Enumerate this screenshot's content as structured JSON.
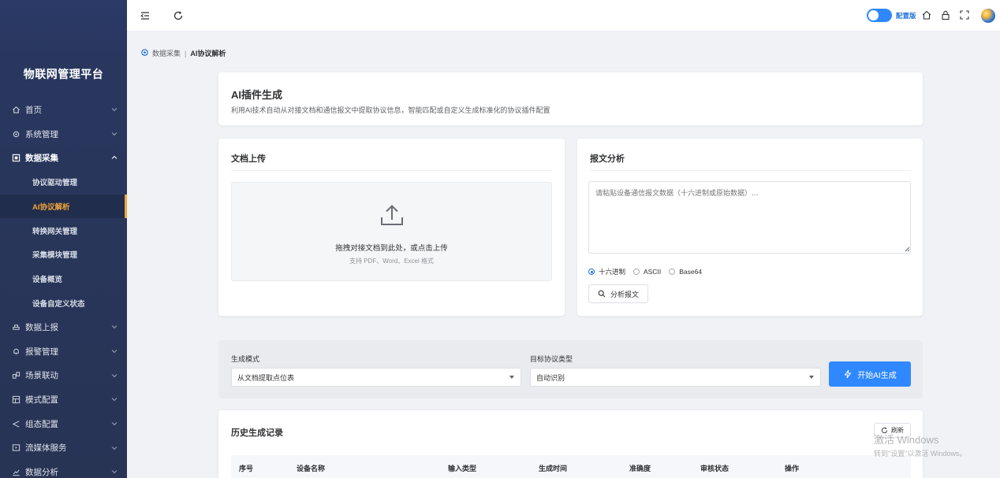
{
  "sidebar": {
    "brand": "物联网管理平台",
    "menu": [
      {
        "label": "首页",
        "icon": "home-icon"
      },
      {
        "label": "系统管理",
        "icon": "settings-icon"
      },
      {
        "label": "数据采集",
        "icon": "monitor-icon"
      }
    ],
    "sub_items": [
      "协议驱动管理",
      "AI协议解析",
      "转换网关管理",
      "采集模块管理",
      "设备概览",
      "设备自定义状态"
    ],
    "menu_after": [
      {
        "label": "数据上报",
        "icon": "upload-cloud-icon"
      },
      {
        "label": "报警管理",
        "icon": "bell-icon"
      },
      {
        "label": "场景联动",
        "icon": "link-icon"
      },
      {
        "label": "模式配置",
        "icon": "grid-icon"
      },
      {
        "label": "组态配置",
        "icon": "share-icon"
      },
      {
        "label": "流媒体服务",
        "icon": "media-icon"
      },
      {
        "label": "数据分析",
        "icon": "chart-icon"
      }
    ]
  },
  "header": {
    "toggle_label": "配置版",
    "icons": [
      "menu-fold-icon",
      "refresh-icon",
      "home-icon",
      "lock-icon",
      "fullscreen-icon"
    ]
  },
  "breadcrumb": {
    "parent": "数据采集",
    "separator": "|",
    "current": "AI协议解析"
  },
  "intro": {
    "title": "AI插件生成",
    "description": "利用AI技术自动从对接文档和通信报文中提取协议信息，智能匹配或自定义生成标准化的协议插件配置"
  },
  "upload_card": {
    "title": "文档上传",
    "main_text": "拖拽对接文档到此处，或点击上传",
    "sub_text": "支持 PDF、Word、Excel 格式"
  },
  "analysis_card": {
    "title": "报文分析",
    "placeholder": "请粘贴设备通信报文数据（十六进制或原始数据）...",
    "formats": [
      "十六进制",
      "ASCII",
      "Base64"
    ],
    "selected_format": "十六进制",
    "analyze_label": "分析报文"
  },
  "generate": {
    "mode_label": "生成模式",
    "mode_value": "从文档提取点位表",
    "protocol_label": "目标协议类型",
    "protocol_value": "自动识别",
    "button_label": "开始AI生成"
  },
  "history": {
    "title": "历史生成记录",
    "refresh_label": "刷新",
    "columns": [
      "序号",
      "设备名称",
      "输入类型",
      "生成时间",
      "准确度",
      "审核状态",
      "操作"
    ]
  },
  "watermark": {
    "line1": "激活 Windows",
    "line2": "转到\"设置\"以激活 Windows。"
  },
  "colors": {
    "primary": "#2f88ff",
    "active_menu": "#f2a33a",
    "sidebar_bg": "#283454"
  }
}
